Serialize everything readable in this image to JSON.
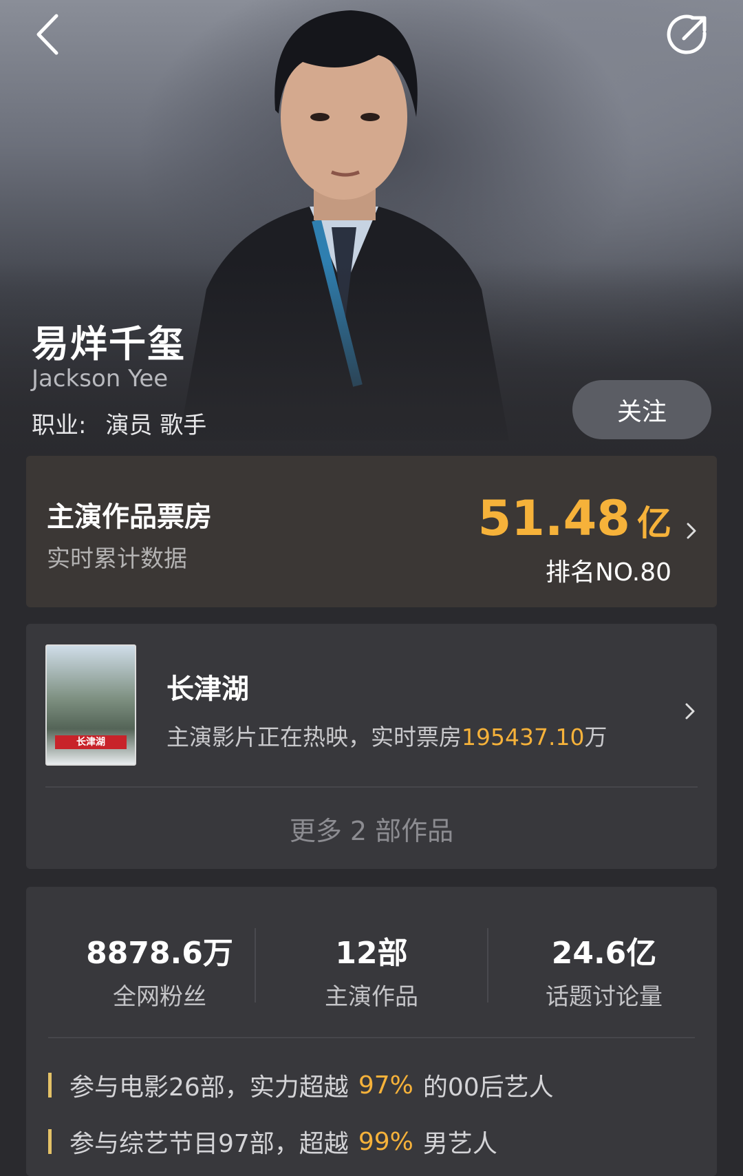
{
  "header": {
    "back_icon": "chevron-left-icon",
    "share_icon": "share-icon"
  },
  "profile": {
    "name": "易烊千玺",
    "english_name": "Jackson Yee",
    "occupation_label": "职业:",
    "occupation_value": "演员 歌手",
    "follow_label": "关注"
  },
  "box_office": {
    "title": "主演作品票房",
    "subtitle": "实时累计数据",
    "value": "51.48",
    "unit": "亿",
    "rank": "排名NO.80"
  },
  "movie": {
    "title": "长津湖",
    "status_text": "主演影片正在热映，实时票房",
    "box_value": "195437.10",
    "box_unit": "万",
    "poster_text": "长津湖",
    "more_label": "更多 2 部作品"
  },
  "stats": [
    {
      "value": "8878.6万",
      "label": "全网粉丝"
    },
    {
      "value": "12部",
      "label": "主演作品"
    },
    {
      "value": "24.6亿",
      "label": "话题讨论量"
    }
  ],
  "facts": [
    {
      "prefix": "参与电影26部，实力超越",
      "percent": "97%",
      "suffix": "的00后艺人"
    },
    {
      "prefix": "参与综艺节目97部，超越",
      "percent": "99%",
      "suffix": "男艺人"
    }
  ],
  "colors": {
    "accent": "#f6b23a",
    "background": "#2a2a2e",
    "card": "#38383c"
  }
}
